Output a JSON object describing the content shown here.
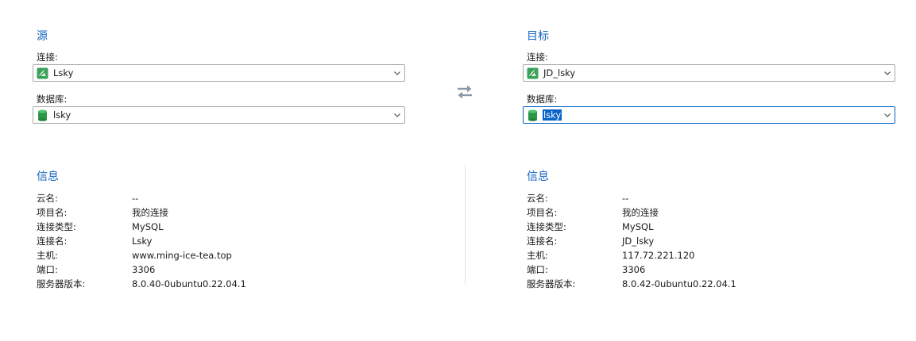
{
  "source": {
    "title": "源",
    "connection_label": "连接:",
    "connection_value": "Lsky",
    "connection_icon": "mysql-connection-icon",
    "database_label": "数据库:",
    "database_value": "lsky",
    "database_icon": "database-icon",
    "info_title": "信息",
    "info": [
      {
        "key": "云名:",
        "value": "--"
      },
      {
        "key": "项目名:",
        "value": "我的连接"
      },
      {
        "key": "连接类型:",
        "value": "MySQL"
      },
      {
        "key": "连接名:",
        "value": "Lsky"
      },
      {
        "key": "主机:",
        "value": "www.ming-ice-tea.top"
      },
      {
        "key": "端口:",
        "value": "3306"
      },
      {
        "key": "服务器版本:",
        "value": "8.0.40-0ubuntu0.22.04.1"
      }
    ]
  },
  "target": {
    "title": "目标",
    "connection_label": "连接:",
    "connection_value": "JD_lsky",
    "connection_icon": "mysql-connection-icon",
    "database_label": "数据库:",
    "database_value": "lsky",
    "database_icon": "database-icon",
    "info_title": "信息",
    "info": [
      {
        "key": "云名:",
        "value": "--"
      },
      {
        "key": "项目名:",
        "value": "我的连接"
      },
      {
        "key": "连接类型:",
        "value": "MySQL"
      },
      {
        "key": "连接名:",
        "value": "JD_lsky"
      },
      {
        "key": "主机:",
        "value": "117.72.221.120"
      },
      {
        "key": "端口:",
        "value": "3306"
      },
      {
        "key": "服务器版本:",
        "value": "8.0.42-0ubuntu0.22.04.1"
      }
    ]
  },
  "swap_icon": "swap-arrows-icon",
  "colors": {
    "accent": "#1565c0",
    "selection": "#0a64c8",
    "combo_border": "#a9a9a9",
    "connection_icon_green": "#3aa35a",
    "database_icon_green": "#2e9e4a"
  }
}
